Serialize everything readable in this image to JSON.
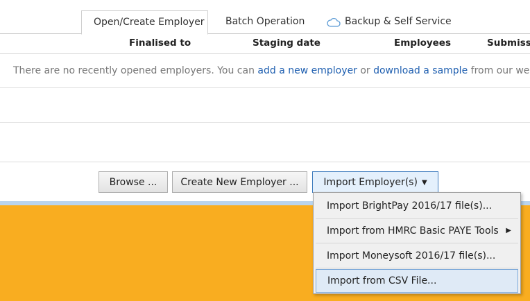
{
  "tabs": [
    {
      "label": "Open/Create Employer"
    },
    {
      "label": "Batch Operation"
    },
    {
      "label": "Backup & Self Service",
      "icon": "cloud-icon"
    }
  ],
  "table": {
    "headers": [
      "Finalised to",
      "Staging date",
      "Employees",
      "Submissio"
    ],
    "empty_message": {
      "prefix": "There are no recently opened employers. You can ",
      "link1": "add a new employer",
      "middle": " or ",
      "link2": "download a sample",
      "suffix": " from our website."
    }
  },
  "buttons": {
    "browse": "Browse ...",
    "create": "Create New Employer ...",
    "import": "Import Employer(s)"
  },
  "menu": {
    "items": [
      {
        "label": "Import BrightPay 2016/17 file(s)..."
      },
      {
        "label": "Import from HMRC Basic PAYE Tools",
        "has_submenu": true
      },
      {
        "label": "Import Moneysoft 2016/17 file(s)..."
      },
      {
        "label": "Import from CSV File..."
      }
    ]
  },
  "colors": {
    "accent": "#f9ad20",
    "link": "#1f5fb0",
    "highlight": "#dfeaf6"
  }
}
